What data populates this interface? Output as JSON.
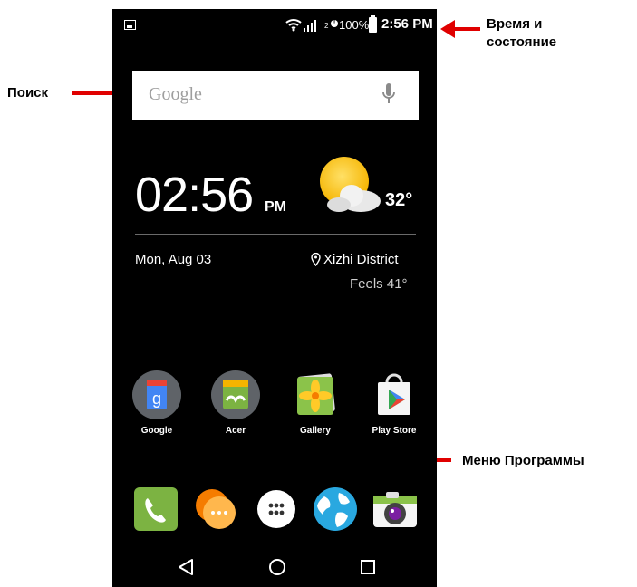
{
  "status_bar": {
    "battery_percent": "100%",
    "sim_label": "2",
    "time": "2:56 PM"
  },
  "search": {
    "placeholder": "Google"
  },
  "clock_widget": {
    "time": "02:56",
    "ampm": "PM",
    "temperature": "32°",
    "date": "Mon, Aug 03",
    "location": "Xizhi District",
    "feels_like": "Feels 41°"
  },
  "apps": [
    {
      "label": "Google",
      "icon": "google-icon"
    },
    {
      "label": "Acer",
      "icon": "acer-icon"
    },
    {
      "label": "Gallery",
      "icon": "gallery-icon"
    },
    {
      "label": "Play Store",
      "icon": "play-store-icon"
    }
  ],
  "dock": [
    {
      "icon": "phone-icon"
    },
    {
      "icon": "messaging-icon"
    },
    {
      "icon": "app-drawer-icon"
    },
    {
      "icon": "browser-globe-icon"
    },
    {
      "icon": "camera-icon"
    }
  ],
  "nav": [
    "back-icon",
    "home-icon",
    "recents-icon"
  ],
  "annotations": {
    "time_status_line1": "Время и",
    "time_status_line2": "состояние",
    "search": "Поиск",
    "apps_menu": "Меню Программы"
  },
  "colors": {
    "annotation_arrow": "#e00000",
    "screen_bg": "#000000"
  }
}
